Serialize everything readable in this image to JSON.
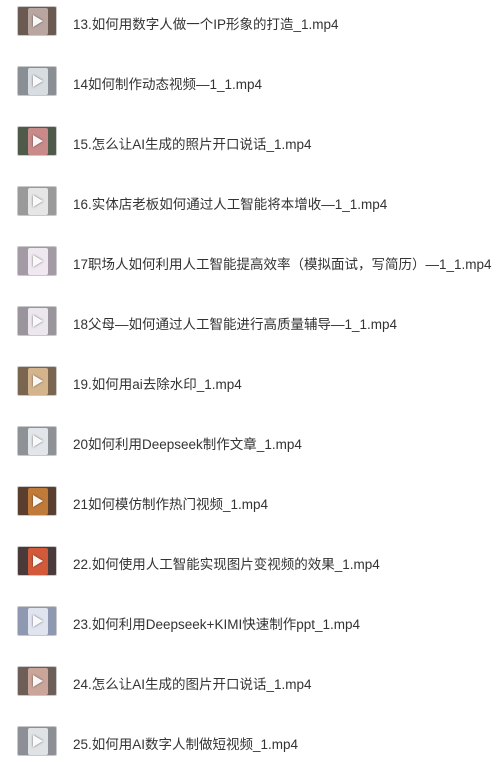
{
  "files": [
    {
      "name": "13.如何用数字人做一个IP形象的打造_1.mp4",
      "thumb": {
        "bg": "#6a5a52",
        "screen": "#b9a6a0"
      }
    },
    {
      "name": "14如何制作动态视频—1_1.mp4",
      "thumb": {
        "bg": "#8a8f95",
        "screen": "#d8dde2"
      }
    },
    {
      "name": "15.怎么让AI生成的照片开口说话_1.mp4",
      "thumb": {
        "bg": "#4f5a4a",
        "screen": "#c98a8a"
      }
    },
    {
      "name": "16.实体店老板如何通过人工智能将本增收—1_1.mp4",
      "thumb": {
        "bg": "#9a9a9a",
        "screen": "#e6e6e6"
      }
    },
    {
      "name": "17职场人如何利用人工智能提高效率（模拟面试，写简历）—1_1.mp4",
      "thumb": {
        "bg": "#a39aa6",
        "screen": "#efe8f0"
      }
    },
    {
      "name": "18父母—如何通过人工智能进行高质量辅导—1_1.mp4",
      "thumb": {
        "bg": "#9a949c",
        "screen": "#ece6ee"
      }
    },
    {
      "name": "19.如何用ai去除水印_1.mp4",
      "thumb": {
        "bg": "#7a6650",
        "screen": "#d4b48c"
      }
    },
    {
      "name": "20如何利用Deepseek制作文章_1.mp4",
      "thumb": {
        "bg": "#8e9296",
        "screen": "#e2e6ea"
      }
    },
    {
      "name": "21如何模仿制作热门视频_1.mp4",
      "thumb": {
        "bg": "#5a3e2e",
        "screen": "#c07a3a"
      }
    },
    {
      "name": "22.如何使用人工智能实现图片变视频的效果_1.mp4",
      "thumb": {
        "bg": "#4a3a3a",
        "screen": "#d25a3a"
      }
    },
    {
      "name": "23.如何利用Deepseek+KIMI快速制作ppt_1.mp4",
      "thumb": {
        "bg": "#8e98b0",
        "screen": "#dfe4ef"
      }
    },
    {
      "name": "24.怎么让AI生成的图片开口说话_1.mp4",
      "thumb": {
        "bg": "#6e5e58",
        "screen": "#c9a59a"
      }
    },
    {
      "name": "25.如何用AI数字人制做短视频_1.mp4",
      "thumb": {
        "bg": "#8c9096",
        "screen": "#e0e3e6"
      }
    }
  ]
}
